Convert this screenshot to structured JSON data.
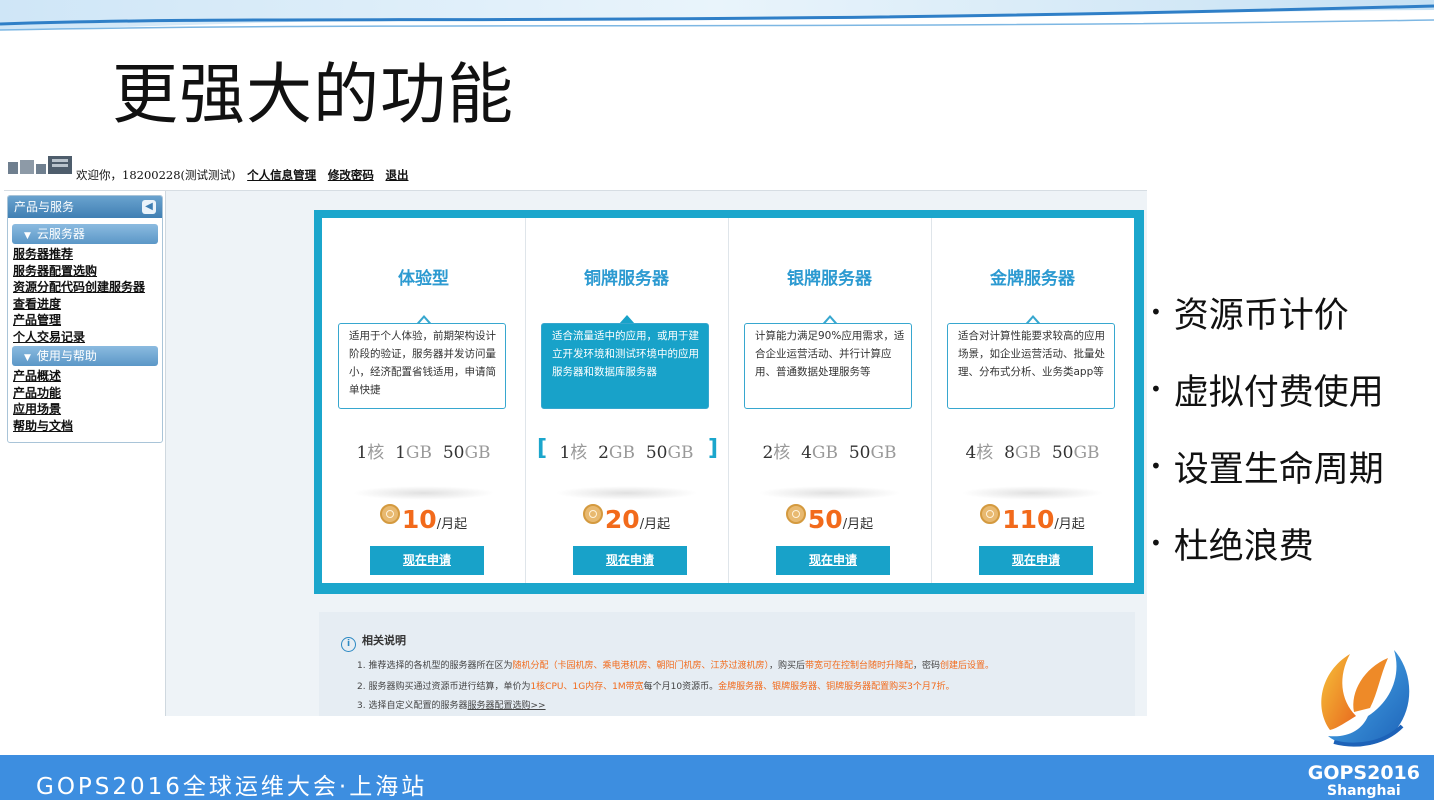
{
  "slide": {
    "title": "更强大的功能",
    "bullets": [
      "资源币计价",
      "虚拟付费使用",
      "设置生命周期",
      "杜绝浪费"
    ]
  },
  "header": {
    "welcome": "欢迎你，18200228(测试测试)",
    "links": [
      "个人信息管理",
      "修改密码",
      "退出"
    ]
  },
  "sidebar": {
    "panel_title": "产品与服务",
    "sections": [
      {
        "title": "云服务器",
        "items": [
          "服务器推荐",
          "服务器配置选购",
          "资源分配代码创建服务器",
          "查看进度",
          "产品管理",
          "个人交易记录"
        ]
      },
      {
        "title": "使用与帮助",
        "items": [
          "产品概述",
          "产品功能",
          "应用场景",
          "帮助与文档"
        ]
      }
    ]
  },
  "plans": [
    {
      "name": "体验型",
      "desc": "适用于个人体验，前期架构设计阶段的验证，服务器并发访问量小，经济配置省钱适用，申请简单快捷",
      "cpu": "1",
      "ram": "1",
      "disk": "50",
      "price": "10",
      "button": "现在申请",
      "selected": false
    },
    {
      "name": "铜牌服务器",
      "desc": "适合流量适中的应用，或用于建立开发环境和测试环境中的应用服务器和数据库服务器",
      "cpu": "1",
      "ram": "2",
      "disk": "50",
      "price": "20",
      "button": "现在申请",
      "selected": true
    },
    {
      "name": "银牌服务器",
      "desc": "计算能力满足90%应用需求，适合企业运营活动、并行计算应用、普通数据处理服务等",
      "cpu": "2",
      "ram": "4",
      "disk": "50",
      "price": "50",
      "button": "现在申请",
      "selected": false
    },
    {
      "name": "金牌服务器",
      "desc": "适合对计算性能要求较高的应用场景，如企业运营活动、批量处理、分布式分析、业务类app等",
      "cpu": "4",
      "ram": "8",
      "disk": "50",
      "price": "110",
      "button": "现在申请",
      "selected": false
    }
  ],
  "units": {
    "core": "核",
    "gb": "GB",
    "per_month": "/月起"
  },
  "notes": {
    "title": "相关说明",
    "line1": {
      "a": "1. 推荐选择的各机型的服务器所在区为",
      "b": "随机分配（卡园机房、乘电港机房、朝阳门机房、江苏过渡机房）",
      "c": "，购买后",
      "d": "带宽可在控制台随时升降配",
      "e": "，密码",
      "f": "创建后设置。"
    },
    "line2": {
      "a": "2. 服务器购买通过资源币进行结算，单价为",
      "b": "1核CPU、1G内存、1M带宽",
      "c": "每个月10资源币。",
      "d": "金牌服务器、银牌服务器、铜牌服务器配置",
      "e": "购买3个月7折。"
    },
    "line3": {
      "a": "3. 选择自定义配置的服务器",
      "b": "服务器配置选购>>"
    }
  },
  "footer": {
    "text": "GOPS2016全球运维大会·上海站",
    "brand_line1": "GOPS2016",
    "brand_line2": "Shanghai"
  },
  "colors": {
    "accent": "#1ba6cc",
    "price": "#f26a1b",
    "footer": "#3d8ee0",
    "title_blue": "#2c9ad1"
  }
}
